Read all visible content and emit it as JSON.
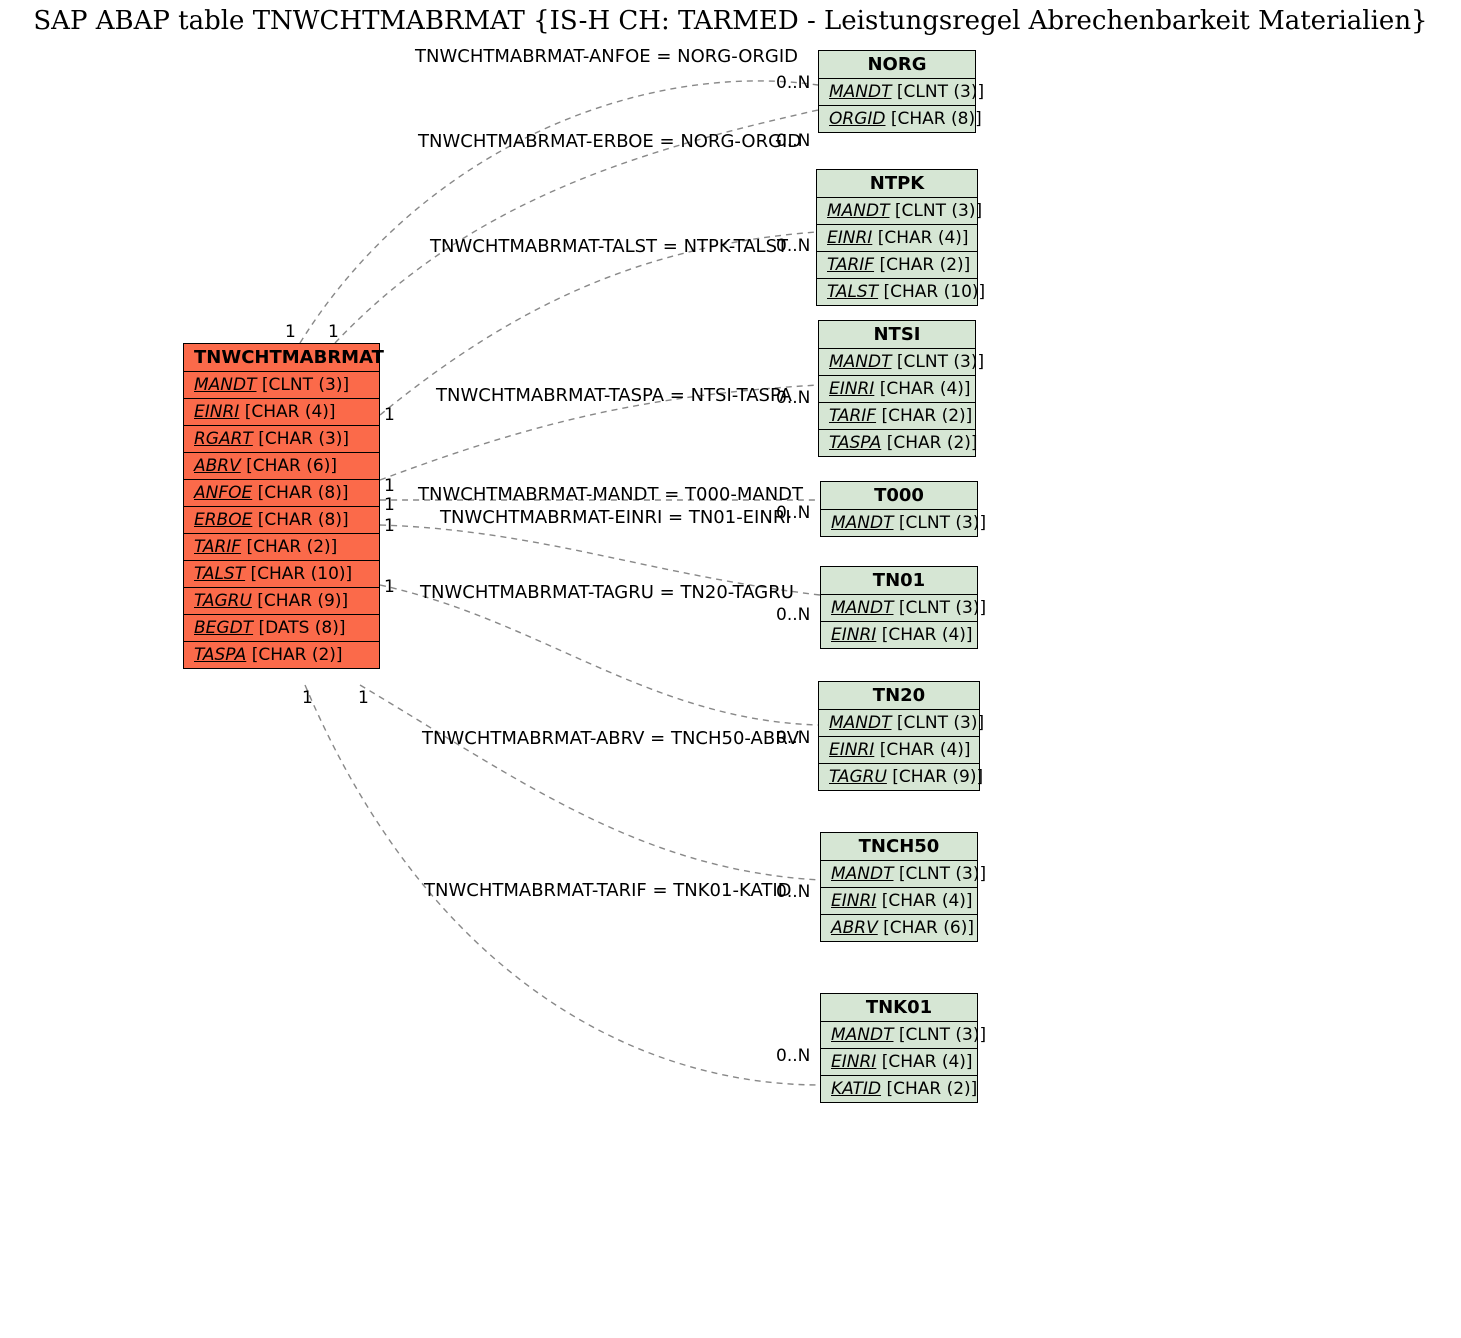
{
  "title": "SAP ABAP table TNWCHTMABRMAT {IS-H CH: TARMED - Leistungsregel Abrechenbarkeit Materialien}",
  "main_entity": {
    "name": "TNWCHTMABRMAT",
    "fields": [
      {
        "name": "MANDT",
        "type": "[CLNT (3)]"
      },
      {
        "name": "EINRI",
        "type": "[CHAR (4)]"
      },
      {
        "name": "RGART",
        "type": "[CHAR (3)]"
      },
      {
        "name": "ABRV",
        "type": "[CHAR (6)]"
      },
      {
        "name": "ANFOE",
        "type": "[CHAR (8)]"
      },
      {
        "name": "ERBOE",
        "type": "[CHAR (8)]"
      },
      {
        "name": "TARIF",
        "type": "[CHAR (2)]"
      },
      {
        "name": "TALST",
        "type": "[CHAR (10)]"
      },
      {
        "name": "TAGRU",
        "type": "[CHAR (9)]"
      },
      {
        "name": "BEGDT",
        "type": "[DATS (8)]"
      },
      {
        "name": "TASPA",
        "type": "[CHAR (2)]"
      }
    ]
  },
  "related": [
    {
      "name": "NORG",
      "fields": [
        {
          "name": "MANDT",
          "type": "[CLNT (3)]"
        },
        {
          "name": "ORGID",
          "type": "[CHAR (8)]"
        }
      ]
    },
    {
      "name": "NTPK",
      "fields": [
        {
          "name": "MANDT",
          "type": "[CLNT (3)]"
        },
        {
          "name": "EINRI",
          "type": "[CHAR (4)]"
        },
        {
          "name": "TARIF",
          "type": "[CHAR (2)]"
        },
        {
          "name": "TALST",
          "type": "[CHAR (10)]"
        }
      ]
    },
    {
      "name": "NTSI",
      "fields": [
        {
          "name": "MANDT",
          "type": "[CLNT (3)]"
        },
        {
          "name": "EINRI",
          "type": "[CHAR (4)]"
        },
        {
          "name": "TARIF",
          "type": "[CHAR (2)]"
        },
        {
          "name": "TASPA",
          "type": "[CHAR (2)]"
        }
      ]
    },
    {
      "name": "T000",
      "fields": [
        {
          "name": "MANDT",
          "type": "[CLNT (3)]"
        }
      ]
    },
    {
      "name": "TN01",
      "fields": [
        {
          "name": "MANDT",
          "type": "[CLNT (3)]"
        },
        {
          "name": "EINRI",
          "type": "[CHAR (4)]"
        }
      ]
    },
    {
      "name": "TN20",
      "fields": [
        {
          "name": "MANDT",
          "type": "[CLNT (3)]"
        },
        {
          "name": "EINRI",
          "type": "[CHAR (4)]"
        },
        {
          "name": "TAGRU",
          "type": "[CHAR (9)]"
        }
      ]
    },
    {
      "name": "TNCH50",
      "fields": [
        {
          "name": "MANDT",
          "type": "[CLNT (3)]"
        },
        {
          "name": "EINRI",
          "type": "[CHAR (4)]"
        },
        {
          "name": "ABRV",
          "type": "[CHAR (6)]"
        }
      ]
    },
    {
      "name": "TNK01",
      "fields": [
        {
          "name": "MANDT",
          "type": "[CLNT (3)]"
        },
        {
          "name": "EINRI",
          "type": "[CHAR (4)]"
        },
        {
          "name": "KATID",
          "type": "[CHAR (2)]"
        }
      ]
    }
  ],
  "relations": [
    {
      "label": "TNWCHTMABRMAT-ANFOE = NORG-ORGID"
    },
    {
      "label": "TNWCHTMABRMAT-ERBOE = NORG-ORGID"
    },
    {
      "label": "TNWCHTMABRMAT-TALST = NTPK-TALST"
    },
    {
      "label": "TNWCHTMABRMAT-TASPA = NTSI-TASPA"
    },
    {
      "label": "TNWCHTMABRMAT-MANDT = T000-MANDT"
    },
    {
      "label": "TNWCHTMABRMAT-EINRI = TN01-EINRI"
    },
    {
      "label": "TNWCHTMABRMAT-TAGRU = TN20-TAGRU"
    },
    {
      "label": "TNWCHTMABRMAT-ABRV = TNCH50-ABRV"
    },
    {
      "label": "TNWCHTMABRMAT-TARIF = TNK01-KATID"
    }
  ],
  "cardinality": {
    "one": "1",
    "many": "0..N"
  }
}
